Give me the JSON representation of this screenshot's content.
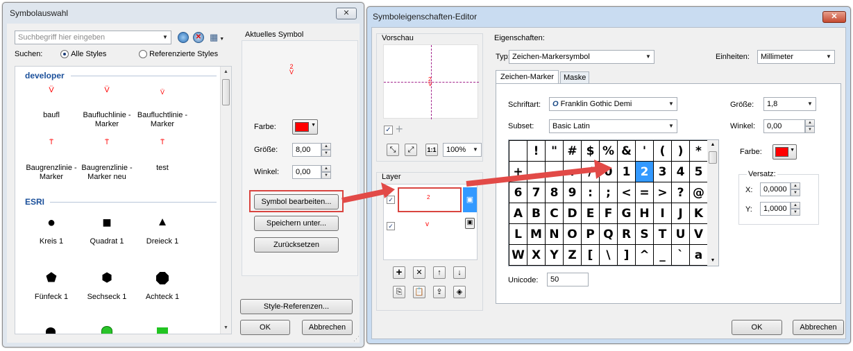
{
  "symbol_selector": {
    "title": "Symbolauswahl",
    "close_label": "✕",
    "search_placeholder": "Suchbegriff hier eingeben",
    "search_label": "Suchen:",
    "radio_all_styles": "Alle Styles",
    "radio_referenced": "Referenzierte Styles",
    "groups": [
      {
        "name": "developer",
        "items": [
          {
            "label": "baufl",
            "glyph": "V̈"
          },
          {
            "label": "Baufluchlinie - Marker",
            "glyph": "V̈"
          },
          {
            "label": "Baufluchtlinie - Marker",
            "glyph": "V̈"
          },
          {
            "label": "Baugrenzlinie - Marker",
            "glyph": "T̈"
          },
          {
            "label": "Baugrenzlinie - Marker neu",
            "glyph": "T̈"
          },
          {
            "label": "test",
            "glyph": "T̈"
          }
        ]
      },
      {
        "name": "ESRI",
        "items": [
          {
            "label": "Kreis 1",
            "glyph": "●"
          },
          {
            "label": "Quadrat 1",
            "glyph": "■"
          },
          {
            "label": "Dreieck 1",
            "glyph": "▲"
          },
          {
            "label": "Fünfeck 1",
            "glyph": "⬟"
          },
          {
            "label": "Sechseck 1",
            "glyph": "⬢"
          },
          {
            "label": "Achteck 1",
            "glyph": "⯃"
          }
        ]
      }
    ],
    "current_symbol_label": "Aktuelles Symbol",
    "color_label": "Farbe:",
    "size_label": "Größe:",
    "size_value": "8,00",
    "angle_label": "Winkel:",
    "angle_value": "0,00",
    "edit_button": "Symbol bearbeiten...",
    "save_as_button": "Speichern unter...",
    "reset_button": "Zurücksetzen",
    "style_refs_button": "Style-Referenzen...",
    "ok_button": "OK",
    "cancel_button": "Abbrechen"
  },
  "property_editor": {
    "title": "Symboleigenschaften-Editor",
    "close_label": "✕",
    "preview_label": "Vorschau",
    "zoom_value": "100%",
    "layer_label": "Layer",
    "properties_label": "Eigenschaften:",
    "type_label": "Typ:",
    "type_value": "Zeichen-Markersymbol",
    "units_label": "Einheiten:",
    "units_value": "Millimeter",
    "tabs": [
      "Zeichen-Marker",
      "Maske"
    ],
    "font_label": "Schriftart:",
    "font_value": "Franklin Gothic Demi",
    "subset_label": "Subset:",
    "subset_value": "Basic Latin",
    "size_label": "Größe:",
    "size_value": "1,8",
    "angle_label": "Winkel:",
    "angle_value": "0,00",
    "color_label": "Farbe:",
    "offset_label": "Versatz:",
    "offset_x_label": "X:",
    "offset_x_value": "0,0000",
    "offset_y_label": "Y:",
    "offset_y_value": "1,0000",
    "unicode_label": "Unicode:",
    "unicode_value": "50",
    "selected_char": "2",
    "char_rows": [
      [
        " ",
        "!",
        "\"",
        "#",
        "$",
        "%",
        "&",
        "'",
        "(",
        ")",
        "*"
      ],
      [
        "+",
        ",",
        "-",
        ".",
        "/",
        "0",
        "1",
        "2",
        "3",
        "4",
        "5"
      ],
      [
        "6",
        "7",
        "8",
        "9",
        ":",
        ";",
        "<",
        "=",
        ">",
        "?",
        "@"
      ],
      [
        "A",
        "B",
        "C",
        "D",
        "E",
        "F",
        "G",
        "H",
        "I",
        "J",
        "K"
      ],
      [
        "L",
        "M",
        "N",
        "O",
        "P",
        "Q",
        "R",
        "S",
        "T",
        "U",
        "V"
      ],
      [
        "W",
        "X",
        "Y",
        "Z",
        "[",
        "\\",
        "]",
        "^",
        "_",
        "`",
        "a"
      ]
    ],
    "ok_button": "OK",
    "cancel_button": "Abbrechen"
  },
  "colors": {
    "accent_red": "#e81123",
    "symbol_red": "#ff0000",
    "selection_blue": "#3399ff",
    "arrow_red": "#e24a47"
  }
}
